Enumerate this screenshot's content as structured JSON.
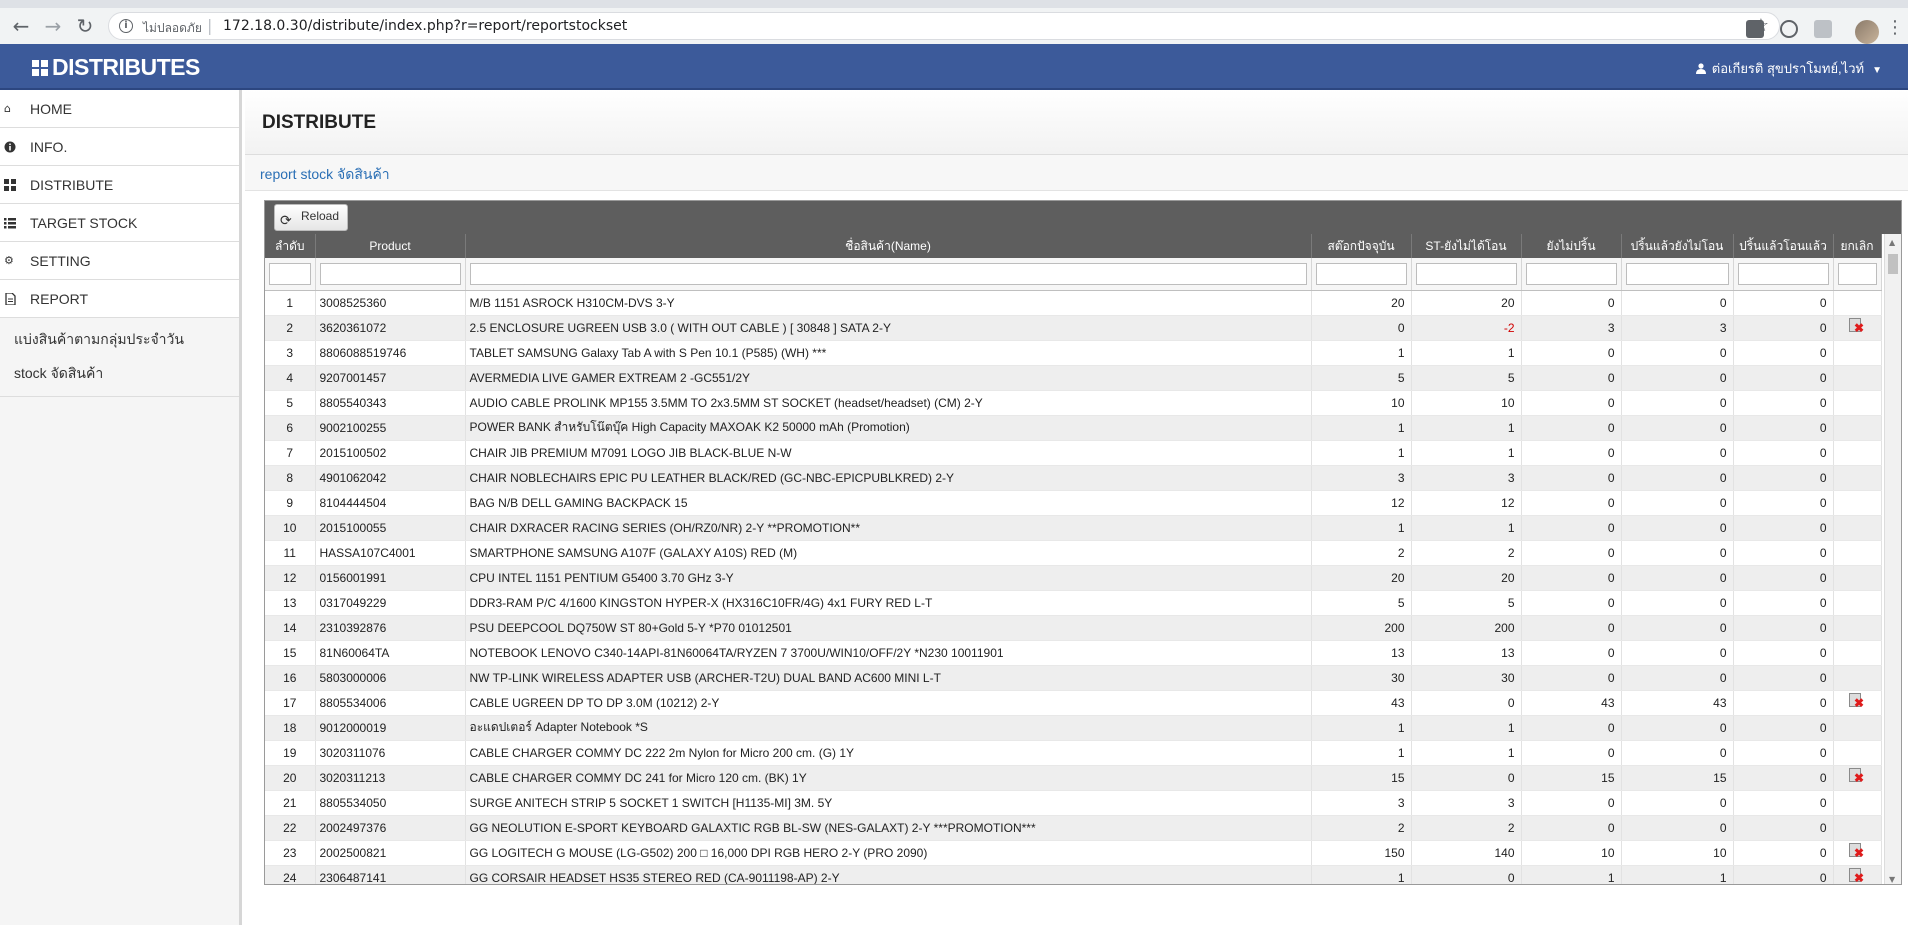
{
  "browser": {
    "insecure_label": "ไม่ปลอดภัย",
    "url": "172.18.0.30/distribute/index.php?r=report/reportstockset",
    "icons": [
      "back-icon",
      "forward-icon",
      "reload-icon",
      "info-icon",
      "star-icon",
      "menu-icon"
    ]
  },
  "header": {
    "brand": "DISTRIBUTES",
    "user_name": "ต่อเกียรติ สุขปราโมทย์,ไวท์",
    "colors": {
      "bar": "#3c5a9a",
      "text": "#ffffff"
    }
  },
  "sidebar": {
    "items": [
      {
        "label": "HOME",
        "icon": "home-icon"
      },
      {
        "label": "INFO.",
        "icon": "info-icon"
      },
      {
        "label": "DISTRIBUTE",
        "icon": "grid-icon"
      },
      {
        "label": "TARGET STOCK",
        "icon": "list-icon"
      },
      {
        "label": "SETTING",
        "icon": "gears-icon"
      },
      {
        "label": "REPORT",
        "icon": "document-icon"
      }
    ],
    "sub_items": [
      {
        "label": "แบ่งสินค้าตามกลุ่มประจำวัน"
      },
      {
        "label": "stock จัดสินค้า"
      }
    ]
  },
  "main": {
    "title": "DISTRIBUTE",
    "breadcrumb": "report stock จัดสินค้า",
    "reload_label": "Reload"
  },
  "table": {
    "columns": [
      {
        "label": "ลำดับ"
      },
      {
        "label": "Product"
      },
      {
        "label": "ชื่อสินค้า(Name)"
      },
      {
        "label": "สต๊อกปัจจุบัน"
      },
      {
        "label": "ST-ยังไม่ได้โอน"
      },
      {
        "label": "ยังไม่ปริ้น"
      },
      {
        "label": "ปริ้นแล้วยังไม่โอน"
      },
      {
        "label": "ปริ้นแล้วโอนแล้ว"
      },
      {
        "label": "ยกเลิก"
      }
    ],
    "rows": [
      {
        "no": "1",
        "product": "3008525360",
        "name": "M/B 1151 ASROCK H310CM-DVS 3-Y",
        "stock": "20",
        "st_pending": "20",
        "not_printed": "0",
        "printed_not_transferred": "0",
        "printed_transferred": "0",
        "cancel": false
      },
      {
        "no": "2",
        "product": "3620361072",
        "name": "2.5 ENCLOSURE UGREEN USB 3.0 ( WITH OUT CABLE ) [ 30848 ] SATA 2-Y",
        "stock": "0",
        "st_pending": "-2",
        "not_printed": "3",
        "printed_not_transferred": "3",
        "printed_transferred": "0",
        "cancel": true
      },
      {
        "no": "3",
        "product": "8806088519746",
        "name": "TABLET SAMSUNG Galaxy Tab A with S Pen 10.1 (P585) (WH) ***",
        "stock": "1",
        "st_pending": "1",
        "not_printed": "0",
        "printed_not_transferred": "0",
        "printed_transferred": "0",
        "cancel": false
      },
      {
        "no": "4",
        "product": "9207001457",
        "name": "AVERMEDIA LIVE GAMER EXTREAM 2 -GC551/2Y",
        "stock": "5",
        "st_pending": "5",
        "not_printed": "0",
        "printed_not_transferred": "0",
        "printed_transferred": "0",
        "cancel": false
      },
      {
        "no": "5",
        "product": "8805540343",
        "name": "AUDIO CABLE PROLINK MP155 3.5MM TO 2x3.5MM ST SOCKET (headset/headset) (CM) 2-Y",
        "stock": "10",
        "st_pending": "10",
        "not_printed": "0",
        "printed_not_transferred": "0",
        "printed_transferred": "0",
        "cancel": false
      },
      {
        "no": "6",
        "product": "9002100255",
        "name": "POWER BANK สำหรับโน๊ตบุ๊ค High Capacity MAXOAK K2 50000 mAh (Promotion)",
        "stock": "1",
        "st_pending": "1",
        "not_printed": "0",
        "printed_not_transferred": "0",
        "printed_transferred": "0",
        "cancel": false
      },
      {
        "no": "7",
        "product": "2015100502",
        "name": "CHAIR JIB PREMIUM M7091 LOGO JIB BLACK-BLUE N-W",
        "stock": "1",
        "st_pending": "1",
        "not_printed": "0",
        "printed_not_transferred": "0",
        "printed_transferred": "0",
        "cancel": false
      },
      {
        "no": "8",
        "product": "4901062042",
        "name": "CHAIR NOBLECHAIRS EPIC PU LEATHER BLACK/RED (GC-NBC-EPICPUBLKRED) 2-Y",
        "stock": "3",
        "st_pending": "3",
        "not_printed": "0",
        "printed_not_transferred": "0",
        "printed_transferred": "0",
        "cancel": false
      },
      {
        "no": "9",
        "product": "8104444504",
        "name": "BAG N/B DELL GAMING BACKPACK 15",
        "stock": "12",
        "st_pending": "12",
        "not_printed": "0",
        "printed_not_transferred": "0",
        "printed_transferred": "0",
        "cancel": false
      },
      {
        "no": "10",
        "product": "2015100055",
        "name": "CHAIR DXRACER RACING SERIES (OH/RZ0/NR) 2-Y **PROMOTION**",
        "stock": "1",
        "st_pending": "1",
        "not_printed": "0",
        "printed_not_transferred": "0",
        "printed_transferred": "0",
        "cancel": false
      },
      {
        "no": "11",
        "product": "HASSA107C4001",
        "name": "SMARTPHONE SAMSUNG A107F (GALAXY A10S) RED (M)",
        "stock": "2",
        "st_pending": "2",
        "not_printed": "0",
        "printed_not_transferred": "0",
        "printed_transferred": "0",
        "cancel": false
      },
      {
        "no": "12",
        "product": "0156001991",
        "name": "CPU INTEL 1151 PENTIUM G5400 3.70 GHz 3-Y",
        "stock": "20",
        "st_pending": "20",
        "not_printed": "0",
        "printed_not_transferred": "0",
        "printed_transferred": "0",
        "cancel": false
      },
      {
        "no": "13",
        "product": "0317049229",
        "name": "DDR3-RAM P/C 4/1600 KINGSTON HYPER-X (HX316C10FR/4G) 4x1 FURY RED L-T",
        "stock": "5",
        "st_pending": "5",
        "not_printed": "0",
        "printed_not_transferred": "0",
        "printed_transferred": "0",
        "cancel": false
      },
      {
        "no": "14",
        "product": "2310392876",
        "name": "PSU DEEPCOOL DQ750W ST 80+Gold 5-Y *P70 01012501",
        "stock": "200",
        "st_pending": "200",
        "not_printed": "0",
        "printed_not_transferred": "0",
        "printed_transferred": "0",
        "cancel": false
      },
      {
        "no": "15",
        "product": "81N60064TA",
        "name": "NOTEBOOK LENOVO C340-14API-81N60064TA/RYZEN 7 3700U/WIN10/OFF/2Y *N230 10011901",
        "stock": "13",
        "st_pending": "13",
        "not_printed": "0",
        "printed_not_transferred": "0",
        "printed_transferred": "0",
        "cancel": false
      },
      {
        "no": "16",
        "product": "5803000006",
        "name": "NW TP-LINK WIRELESS ADAPTER USB (ARCHER-T2U) DUAL BAND AC600 MINI L-T",
        "stock": "30",
        "st_pending": "30",
        "not_printed": "0",
        "printed_not_transferred": "0",
        "printed_transferred": "0",
        "cancel": false
      },
      {
        "no": "17",
        "product": "8805534006",
        "name": "CABLE UGREEN DP TO DP 3.0M (10212) 2-Y",
        "stock": "43",
        "st_pending": "0",
        "not_printed": "43",
        "printed_not_transferred": "43",
        "printed_transferred": "0",
        "cancel": true
      },
      {
        "no": "18",
        "product": "9012000019",
        "name": "อะแดปเตอร์ Adapter Notebook *S",
        "stock": "1",
        "st_pending": "1",
        "not_printed": "0",
        "printed_not_transferred": "0",
        "printed_transferred": "0",
        "cancel": false
      },
      {
        "no": "19",
        "product": "3020311076",
        "name": "CABLE CHARGER COMMY DC 222 2m Nylon for Micro 200 cm. (G) 1Y",
        "stock": "1",
        "st_pending": "1",
        "not_printed": "0",
        "printed_not_transferred": "0",
        "printed_transferred": "0",
        "cancel": false
      },
      {
        "no": "20",
        "product": "3020311213",
        "name": "CABLE CHARGER COMMY DC 241 for Micro 120 cm. (BK) 1Y",
        "stock": "15",
        "st_pending": "0",
        "not_printed": "15",
        "printed_not_transferred": "15",
        "printed_transferred": "0",
        "cancel": true
      },
      {
        "no": "21",
        "product": "8805534050",
        "name": "SURGE ANITECH STRIP 5 SOCKET 1 SWITCH [H1135-MI] 3M. 5Y",
        "stock": "3",
        "st_pending": "3",
        "not_printed": "0",
        "printed_not_transferred": "0",
        "printed_transferred": "0",
        "cancel": false
      },
      {
        "no": "22",
        "product": "2002497376",
        "name": "GG NEOLUTION E-SPORT KEYBOARD GALAXTIC RGB BL-SW (NES-GALAXT) 2-Y ***PROMOTION***",
        "stock": "2",
        "st_pending": "2",
        "not_printed": "0",
        "printed_not_transferred": "0",
        "printed_transferred": "0",
        "cancel": false
      },
      {
        "no": "23",
        "product": "2002500821",
        "name": "GG LOGITECH G MOUSE (LG-G502) 200 □ 16,000 DPI RGB HERO 2-Y (PRO 2090)",
        "stock": "150",
        "st_pending": "140",
        "not_printed": "10",
        "printed_not_transferred": "10",
        "printed_transferred": "0",
        "cancel": true
      },
      {
        "no": "24",
        "product": "2306487141",
        "name": "GG CORSAIR HEADSET HS35 STEREO RED (CA-9011198-AP) 2-Y",
        "stock": "1",
        "st_pending": "0",
        "not_printed": "1",
        "printed_not_transferred": "1",
        "printed_transferred": "0",
        "cancel": true
      }
    ]
  }
}
